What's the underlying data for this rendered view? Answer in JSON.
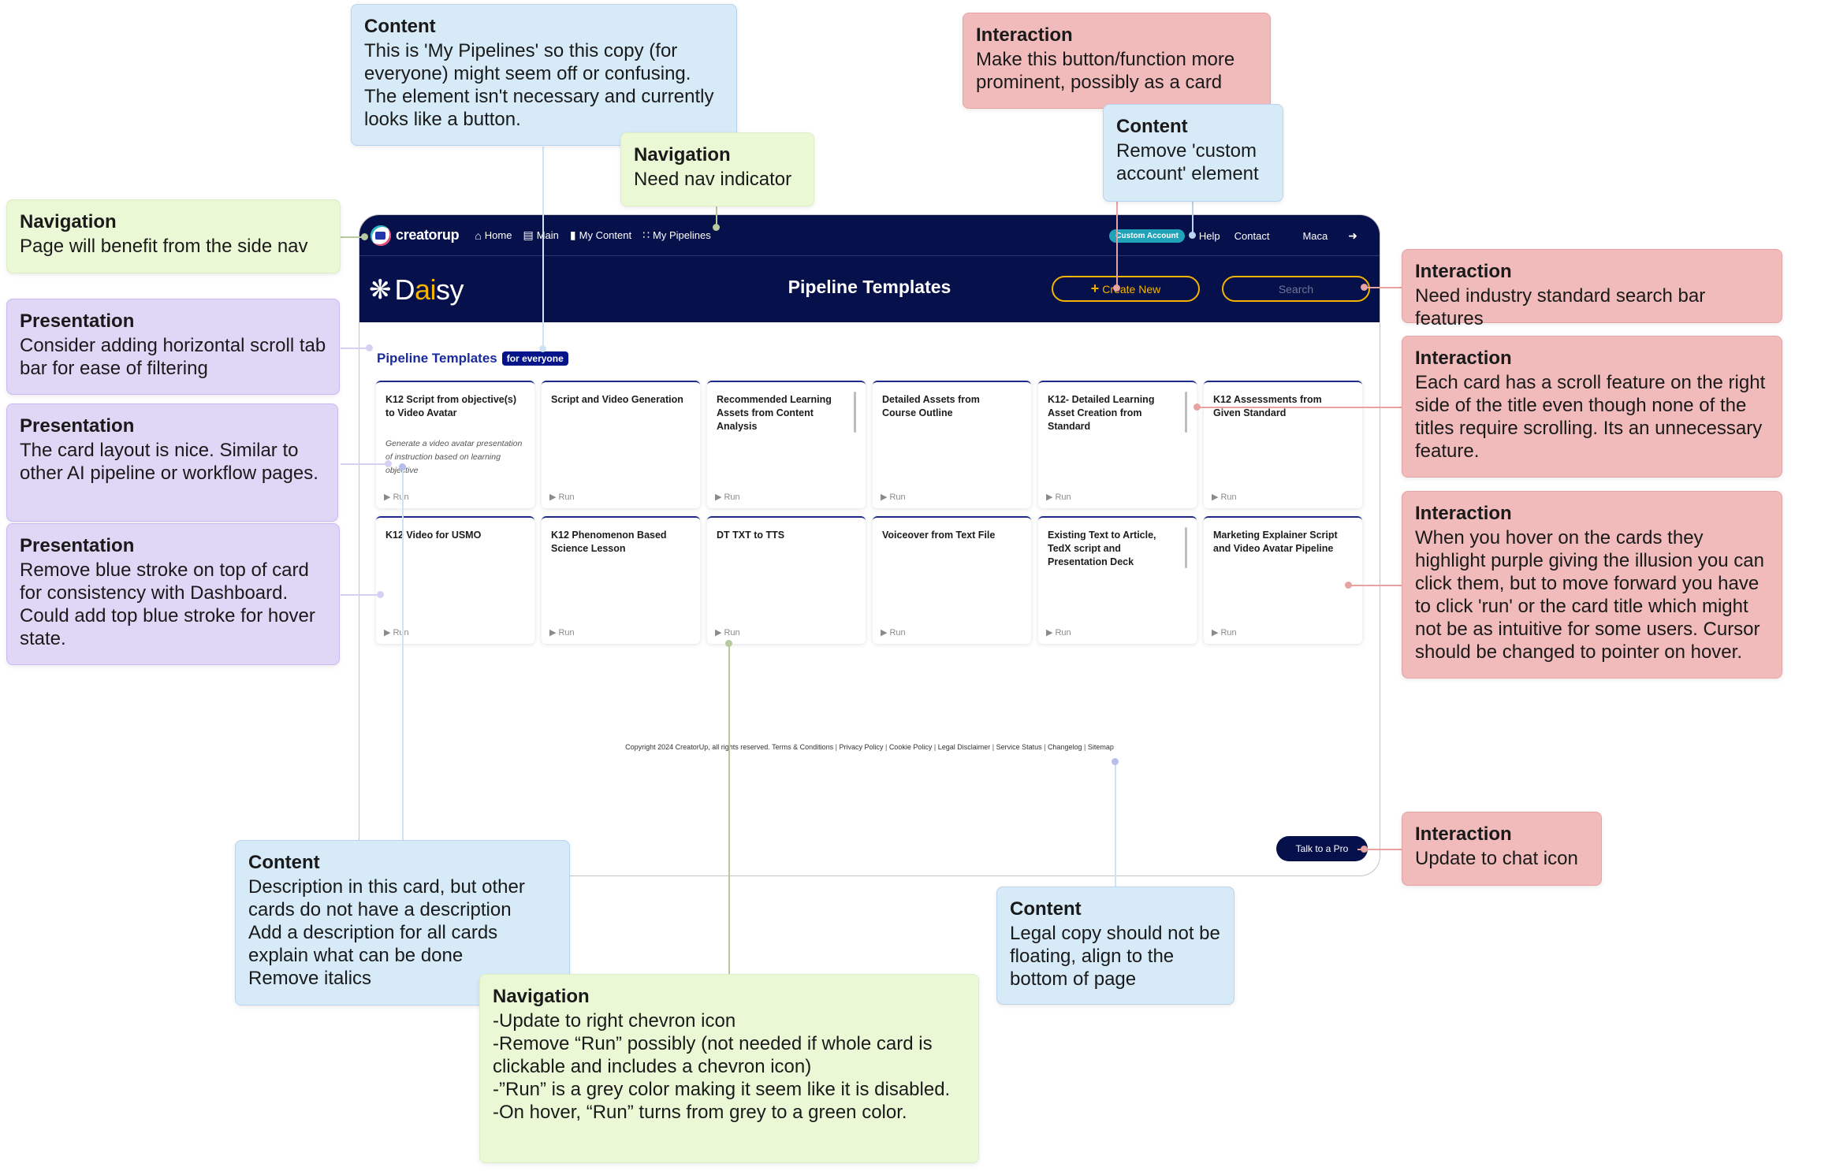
{
  "app": {
    "brand": "creatorup",
    "nav": [
      {
        "label": "Home",
        "icon": "home-icon"
      },
      {
        "label": "Main",
        "icon": "toolbox-icon"
      },
      {
        "label": "My Content",
        "icon": "folder-icon"
      },
      {
        "label": "My Pipelines",
        "icon": "pipeline-icon"
      }
    ],
    "account_badge": "Custom Account",
    "links": [
      "Help",
      "Contact"
    ],
    "user_name": "Maca",
    "logout_icon": "logout-icon",
    "product_name_pre": "D",
    "product_name_accent": "ai",
    "product_name_post": "sy",
    "page_title": "Pipeline Templates",
    "create_button": "Create New",
    "search_placeholder": "Search",
    "section_title": "Pipeline Templates",
    "section_tag": "for everyone",
    "run_label": "Run",
    "cards": [
      {
        "title": "K12 Script from objective(s) to Video Avatar",
        "description": "Generate a video avatar presentation of instruction based on learning objective",
        "scrollbar": false
      },
      {
        "title": "Script and Video Generation",
        "description": "",
        "scrollbar": false
      },
      {
        "title": "Recommended Learning Assets from Content Analysis",
        "description": "",
        "scrollbar": true
      },
      {
        "title": "Detailed Assets from Course Outline",
        "description": "",
        "scrollbar": false
      },
      {
        "title": "K12- Detailed Learning Asset Creation from Standard",
        "description": "",
        "scrollbar": true
      },
      {
        "title": "K12 Assessments from Given Standard",
        "description": "",
        "scrollbar": false
      },
      {
        "title": "K12 Video for USMO",
        "description": "",
        "scrollbar": false
      },
      {
        "title": "K12 Phenomenon Based Science Lesson",
        "description": "",
        "scrollbar": false
      },
      {
        "title": "DT TXT to TTS",
        "description": "",
        "scrollbar": false
      },
      {
        "title": "Voiceover from Text File",
        "description": "",
        "scrollbar": false
      },
      {
        "title": "Existing Text to Article, TedX script and Presentation Deck",
        "description": "",
        "scrollbar": true
      },
      {
        "title": "Marketing Explainer Script and Video Avatar Pipeline",
        "description": "",
        "scrollbar": false
      }
    ],
    "footer": {
      "copyright": "Copyright 2024 CreatorUp, all rights reserved.",
      "links": [
        "Terms & Conditions",
        "Privacy Policy",
        "Cookie Policy",
        "Legal Disclaimer",
        "Service Status",
        "Changelog",
        "Sitemap"
      ]
    },
    "talk_button": "Talk to a Pro",
    "colors": {
      "navy": "#06104a",
      "accent_yellow": "#f4b400",
      "teal_badge": "#20a3b8",
      "section_blue": "#1a2a9a",
      "run_grey": "#8a8a8a"
    }
  },
  "annotations": [
    {
      "id": "n1",
      "category": "Content",
      "text": "This is 'My Pipelines' so this copy (for everyone) might seem off or confusing. The element isn't necessary and currently looks like a button.",
      "type": "content"
    },
    {
      "id": "n2",
      "category": "Navigation",
      "text": "Need nav indicator",
      "type": "nav"
    },
    {
      "id": "n3",
      "category": "Interaction",
      "text": "Make this button/function more prominent, possibly as a card",
      "type": "inter"
    },
    {
      "id": "n4",
      "category": "Content",
      "text": "Remove 'custom account' element",
      "type": "content"
    },
    {
      "id": "n5",
      "category": "Navigation",
      "text": "Page will benefit from the side nav",
      "type": "nav"
    },
    {
      "id": "n6",
      "category": "Presentation",
      "text": "Consider adding horizontal scroll tab bar for ease of filtering",
      "type": "pres"
    },
    {
      "id": "n7",
      "category": "Presentation",
      "text": "The card layout is nice. Similar to other AI pipeline or workflow pages.",
      "type": "pres"
    },
    {
      "id": "n8",
      "category": "Presentation",
      "text": "Remove blue stroke on top of card for consistency with Dashboard. Could add top blue stroke for hover state.",
      "type": "pres"
    },
    {
      "id": "n9",
      "category": "Interaction",
      "text": "Need industry standard search bar features",
      "type": "inter"
    },
    {
      "id": "n10",
      "category": "Interaction",
      "text": "Each card has a scroll feature on the right side of the title even though none of the titles require scrolling. Its an unnecessary feature.",
      "type": "inter"
    },
    {
      "id": "n11",
      "category": "Interaction",
      "text": "When you hover on the cards they highlight purple giving the illusion you can click them, but to move forward you have to click 'run' or the card title which might not be as intuitive for some users. Cursor should be changed to pointer on hover.",
      "type": "inter"
    },
    {
      "id": "n12",
      "category": "Interaction",
      "text": "Update to chat icon",
      "type": "inter"
    },
    {
      "id": "n13",
      "category": "Content",
      "text": "Description in this card, but other cards do not have a description\nAdd a description for all cards\nexplain what can be done\nRemove italics",
      "type": "content"
    },
    {
      "id": "n14",
      "category": "Navigation",
      "text": "-Update to right chevron icon\n-Remove “Run” possibly (not needed if whole card is clickable and includes a chevron icon)\n-”Run” is a grey color making it seem like it is disabled.\n-On hover, “Run” turns from grey to a green color.",
      "type": "nav"
    },
    {
      "id": "n15",
      "category": "Content",
      "text": "Legal copy should not be floating, align to the bottom of page",
      "type": "content"
    }
  ]
}
